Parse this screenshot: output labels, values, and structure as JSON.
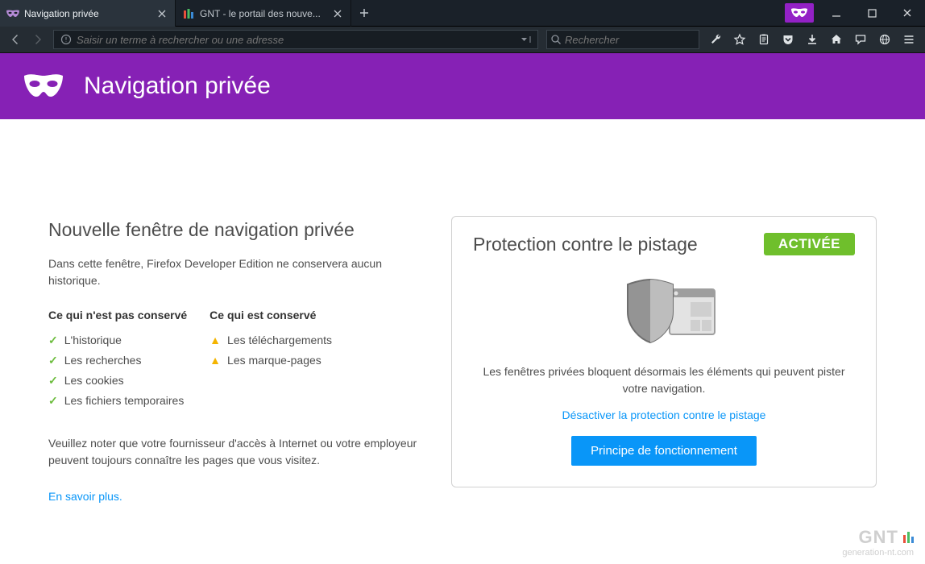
{
  "tabs": [
    {
      "title": "Navigation privée",
      "active": true
    },
    {
      "title": "GNT - le portail des nouve...",
      "active": false
    }
  ],
  "urlbar": {
    "placeholder": "Saisir un terme à rechercher ou une adresse"
  },
  "searchbar": {
    "placeholder": "Rechercher"
  },
  "banner": {
    "title": "Navigation privée"
  },
  "left": {
    "heading": "Nouvelle fenêtre de navigation privée",
    "intro": "Dans cette fenêtre, Firefox Developer Edition ne conservera aucun historique.",
    "not_saved_title": "Ce qui n'est pas conservé",
    "saved_title": "Ce qui est conservé",
    "not_saved": [
      "L'historique",
      "Les recherches",
      "Les cookies",
      "Les fichiers temporaires"
    ],
    "saved": [
      "Les téléchargements",
      "Les marque-pages"
    ],
    "note": "Veuillez noter que votre fournisseur d'accès à Internet ou votre employeur peuvent toujours connaître les pages que vous visitez.",
    "learn_more": "En savoir plus."
  },
  "right": {
    "heading": "Protection contre le pistage",
    "badge": "ACTIVÉE",
    "desc": "Les fenêtres privées bloquent désormais les éléments qui peuvent pister votre navigation.",
    "disable_link": "Désactiver la protection contre le pistage",
    "button": "Principe de fonctionnement"
  },
  "watermark": {
    "brand": "GNT",
    "sub": "generation-nt.com"
  }
}
